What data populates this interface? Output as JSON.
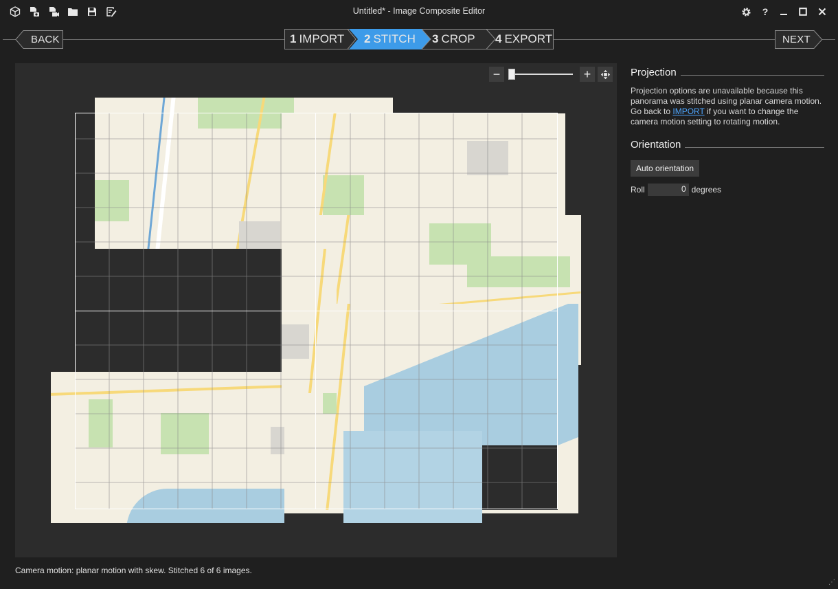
{
  "window": {
    "title": "Untitled* - Image Composite Editor",
    "controls": [
      "gear-icon",
      "help-icon",
      "minimize-icon",
      "maximize-icon",
      "close-icon"
    ]
  },
  "toolbar": {
    "icons": [
      "new-panorama-icon",
      "new-from-images-icon",
      "new-from-video-icon",
      "open-icon",
      "save-icon",
      "publish-icon"
    ]
  },
  "wizard": {
    "back_label": "BACK",
    "next_label": "NEXT",
    "steps": [
      {
        "num": "1",
        "label": "IMPORT",
        "active": false
      },
      {
        "num": "2",
        "label": "STITCH",
        "active": true
      },
      {
        "num": "3",
        "label": "CROP",
        "active": false
      },
      {
        "num": "4",
        "label": "EXPORT",
        "active": false
      }
    ],
    "active_color": "#3d9be9"
  },
  "zoom": {
    "minus": "−",
    "plus": "+",
    "fit_icon": "fit-to-window-icon"
  },
  "panel": {
    "projection": {
      "heading": "Projection",
      "text_before": "Projection options are unavailable because this panorama was stitched using planar camera motion. Go back to ",
      "link": "IMPORT",
      "text_after": " if you want to change the camera motion setting to rotating motion."
    },
    "orientation": {
      "heading": "Orientation",
      "auto_button": "Auto orientation",
      "roll_label": "Roll",
      "roll_value": "0",
      "roll_unit": "degrees"
    }
  },
  "status": "Camera motion: planar motion with skew. Stitched 6 of 6 images.",
  "colors": {
    "background": "#1f1f1f",
    "canvas": "#2c2c2c",
    "accent": "#3d9be9",
    "link": "#4ea6ff"
  }
}
